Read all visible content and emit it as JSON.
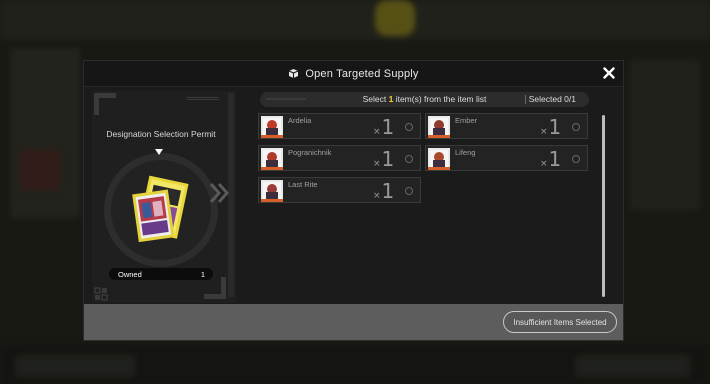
{
  "dialog": {
    "title": "Open Targeted Supply",
    "title_icon": "supply-box-icon",
    "close_icon": "close-icon"
  },
  "permit": {
    "name": "Designation Selection Permit",
    "owned_label": "Owned",
    "owned_count": "1"
  },
  "selection": {
    "prefix": "Select ",
    "count": "1",
    "suffix": " item(s) from the item list",
    "selected_label": "Selected 0/1"
  },
  "items": [
    {
      "name": "Ardelia",
      "qty_prefix": "×",
      "qty": "1",
      "color": "#c0392b"
    },
    {
      "name": "Ember",
      "qty_prefix": "×",
      "qty": "1",
      "color": "#8e3b2e"
    },
    {
      "name": "Pogranichnik",
      "qty_prefix": "×",
      "qty": "1",
      "color": "#b03a2e"
    },
    {
      "name": "Lifeng",
      "qty_prefix": "×",
      "qty": "1",
      "color": "#a84a2a"
    },
    {
      "name": "Last Rite",
      "qty_prefix": "×",
      "qty": "1",
      "color": "#9a3b3b"
    }
  ],
  "footer": {
    "confirm_label": "Insufficient Items Selected"
  },
  "colors": {
    "accent_yellow": "#f2d22e",
    "avatar_border": "#d6602a"
  }
}
